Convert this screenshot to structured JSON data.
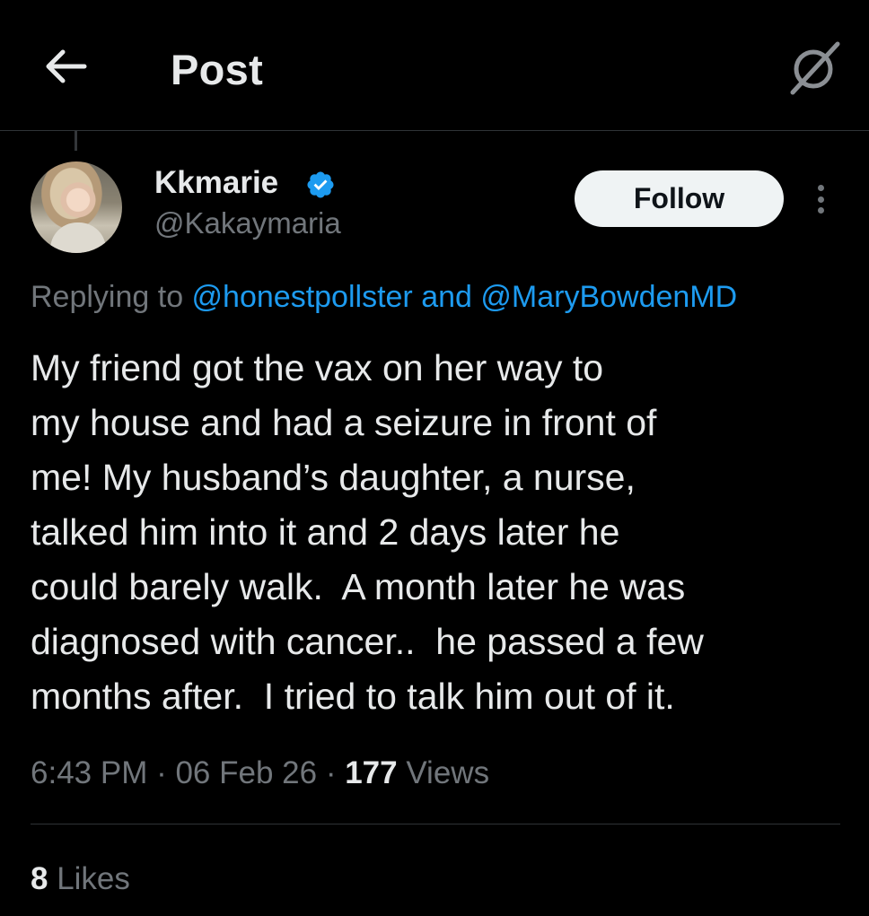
{
  "header": {
    "title": "Post",
    "back_icon": "arrow-left-icon",
    "grok_icon": "grok-icon"
  },
  "author": {
    "display_name": "Kkmarie",
    "handle": "@Kakaymaria",
    "verified": true,
    "verified_color": "#1d9bf0"
  },
  "actions": {
    "follow_label": "Follow",
    "more_icon": "more-vertical-icon"
  },
  "reply_context": {
    "prefix": "Replying to ",
    "mention_1": "@honestpollster",
    "joiner": " and ",
    "mention_2": "@MaryBowdenMD"
  },
  "tweet": {
    "lines": [
      "My friend got the vax on her way to",
      "my house and had a seizure in front of",
      "me! My husband’s daughter, a nurse,",
      "talked him into it and 2 days later he",
      "could barely walk.  A month later he was",
      "diagnosed with cancer..  he passed a few",
      "months after.  I tried to talk him out of it."
    ]
  },
  "meta": {
    "time": "6:43 PM",
    "separator": " · ",
    "date": "06 Feb 26",
    "views_count": "177",
    "views_label": " Views"
  },
  "stats": {
    "likes_count": "8",
    "likes_label": " Likes"
  },
  "colors": {
    "background": "#000000",
    "text_primary": "#e7e9ea",
    "text_secondary": "#71767b",
    "link": "#1d9bf0",
    "border": "#2f3336"
  }
}
